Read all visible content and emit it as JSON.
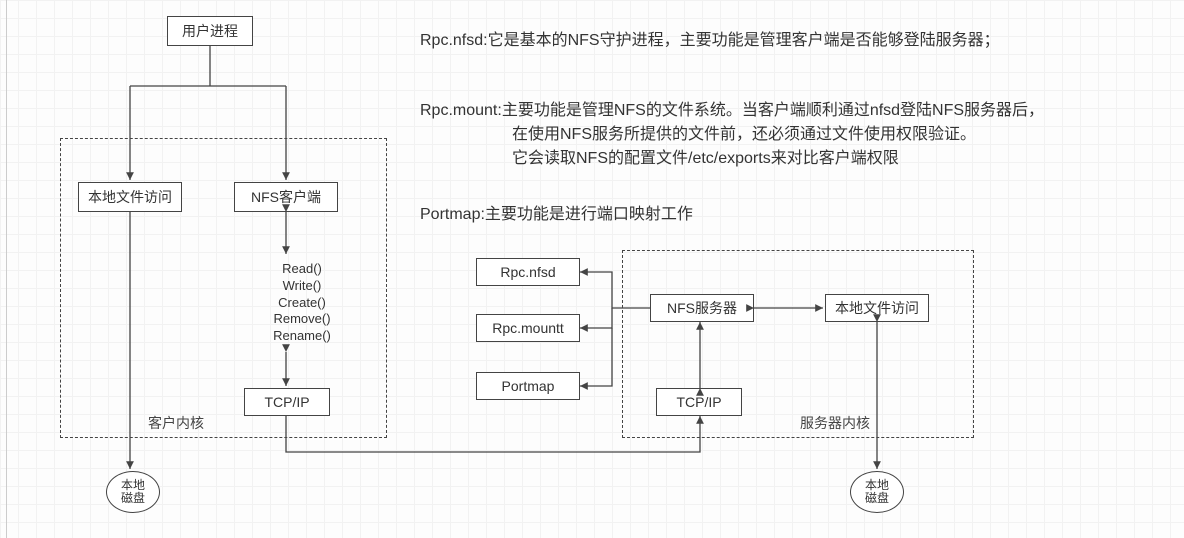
{
  "nodes": {
    "user_process": "用户进程",
    "local_file_access_client": "本地文件访问",
    "nfs_client": "NFS客户端",
    "tcp_ip_client": "TCP/IP",
    "ops_read": "Read()",
    "ops_write": "Write()",
    "ops_create": "Create()",
    "ops_remove": "Remove()",
    "ops_rename": "Rename()",
    "rpc_nfsd": "Rpc.nfsd",
    "rpc_mount": "Rpc.mountt",
    "portmap": "Portmap",
    "nfs_server": "NFS服务器",
    "local_file_access_server": "本地文件访问",
    "tcp_ip_server": "TCP/IP",
    "disk_client": "本地\n磁盘",
    "disk_server": "本地\n磁盘"
  },
  "groups": {
    "client_kernel": "客户内核",
    "server_kernel": "服务器内核"
  },
  "descriptions": {
    "nfsd": "Rpc.nfsd:它是基本的NFS守护进程，主要功能是管理客户端是否能够登陆服务器；",
    "mount_l1": "Rpc.mount:主要功能是管理NFS的文件系统。当客户端顺利通过nfsd登陆NFS服务器后，",
    "mount_l2": "在使用NFS服务所提供的文件前，还必须通过文件使用权限验证。",
    "mount_l3": "它会读取NFS的配置文件/etc/exports来对比客户端权限",
    "portmap": "Portmap:主要功能是进行端口映射工作"
  },
  "watermark": ""
}
